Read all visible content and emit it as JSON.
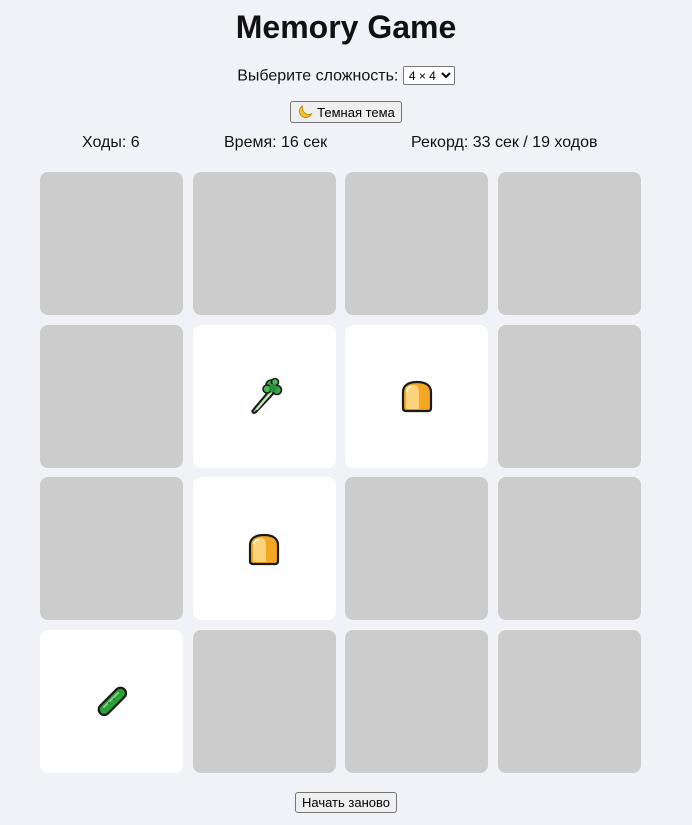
{
  "title": "Memory Game",
  "difficulty": {
    "label": "Выберите сложность:",
    "selected": "4 × 4"
  },
  "theme_button": {
    "icon": "moon-icon",
    "label": "Темная тема"
  },
  "stats": {
    "moves": "Ходы: 6",
    "time": "Время: 16 сек",
    "record": "Рекорд: 33 сек / 19 ходов"
  },
  "board": {
    "rows": 4,
    "cols": 4,
    "cards": [
      {
        "state": "hidden",
        "icon": null
      },
      {
        "state": "hidden",
        "icon": null
      },
      {
        "state": "hidden",
        "icon": null
      },
      {
        "state": "hidden",
        "icon": null
      },
      {
        "state": "hidden",
        "icon": null
      },
      {
        "state": "open",
        "icon": "celery-icon"
      },
      {
        "state": "open",
        "icon": "bread-icon"
      },
      {
        "state": "hidden",
        "icon": null
      },
      {
        "state": "hidden",
        "icon": null
      },
      {
        "state": "open",
        "icon": "bread-icon"
      },
      {
        "state": "hidden",
        "icon": null
      },
      {
        "state": "hidden",
        "icon": null
      },
      {
        "state": "open",
        "icon": "cucumber-icon"
      },
      {
        "state": "hidden",
        "icon": null
      },
      {
        "state": "hidden",
        "icon": null
      },
      {
        "state": "hidden",
        "icon": null
      }
    ]
  },
  "restart_button": {
    "label": "Начать заново"
  },
  "colors": {
    "background": "#f0f2f7",
    "card_hidden": "#cccccc",
    "card_open": "#ffffff"
  }
}
